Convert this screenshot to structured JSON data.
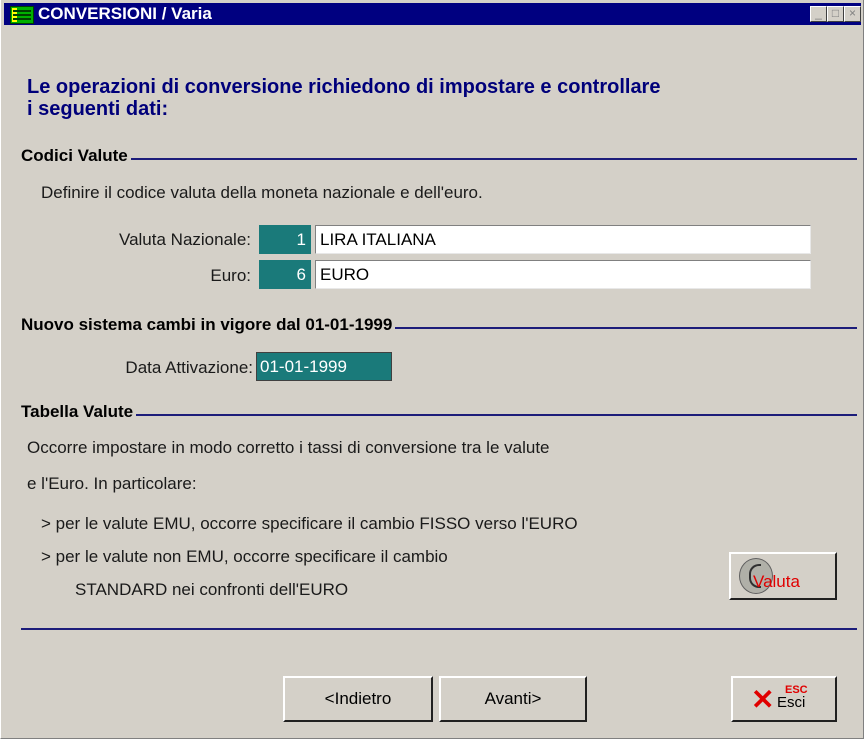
{
  "window": {
    "title": "CONVERSIONI / Varia",
    "controls": {
      "minimize": "_",
      "maximize": "□",
      "close": "×"
    }
  },
  "intro": {
    "line1": "Le operazioni di conversione richiedono di impostare e controllare",
    "line2": "i seguenti dati:"
  },
  "codici_valute": {
    "title": "Codici Valute",
    "description": "Definire il codice valuta della moneta nazionale e dell'euro.",
    "nazionale": {
      "label": "Valuta Nazionale:",
      "code": "1",
      "name": "LIRA ITALIANA"
    },
    "euro": {
      "label": "Euro:",
      "code": "6",
      "name": "EURO"
    }
  },
  "nuovo_sistema": {
    "title": "Nuovo sistema cambi in vigore dal 01-01-1999",
    "date_label": "Data Attivazione:",
    "date_value": "01-01-1999"
  },
  "tabella_valute": {
    "title": "Tabella Valute",
    "line1": "Occorre impostare in modo corretto i tassi di conversione tra le valute",
    "line2": "e l'Euro. In particolare:",
    "bullet1": "> per le valute EMU, occorre specificare il cambio FISSO verso l'EURO",
    "bullet2a": "> per le valute non EMU, occorre specificare il cambio",
    "bullet2b": "STANDARD nei confronti dell'EURO",
    "valuta_button": "Valuta"
  },
  "buttons": {
    "back": "<Indietro",
    "next": "Avanti>",
    "esc_key": "ESC",
    "esc_label": "Esci"
  },
  "colors": {
    "titlebar": "#000080",
    "field_highlight": "#1a7a7a",
    "heading_text": "#00007a",
    "accent_red": "#e00000"
  }
}
